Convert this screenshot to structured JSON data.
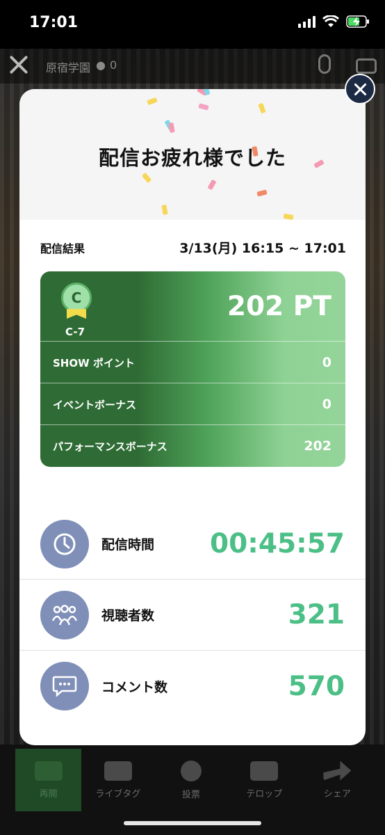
{
  "status_bar": {
    "time": "17:01"
  },
  "stream": {
    "room_name": "原宿学園",
    "viewer_count": "0"
  },
  "toolbar": {
    "items": [
      {
        "label": "再開",
        "icon": "video-camera-icon",
        "active": true
      },
      {
        "label": "ライブタグ",
        "icon": "hashtag-icon",
        "active": false
      },
      {
        "label": "投票",
        "icon": "vote-icon",
        "active": false
      },
      {
        "label": "テロップ",
        "icon": "telop-icon",
        "active": false
      },
      {
        "label": "シェア",
        "icon": "share-icon",
        "active": false
      }
    ]
  },
  "modal": {
    "title": "配信お疲れ様でした",
    "result_label": "配信結果",
    "date_range": "3/13(月) 16:15 ~ 17:01",
    "points_card": {
      "medal_letter": "C",
      "rank": "C-7",
      "total": "202 PT",
      "rows": [
        {
          "label": "SHOW ポイント",
          "value": "0"
        },
        {
          "label": "イベントボーナス",
          "value": "0"
        },
        {
          "label": "パフォーマンスボーナス",
          "value": "202"
        }
      ]
    },
    "stats": [
      {
        "label": "配信時間",
        "value": "00:45:57",
        "icon": "clock-icon"
      },
      {
        "label": "視聴者数",
        "value": "321",
        "icon": "people-icon"
      },
      {
        "label": "コメント数",
        "value": "570",
        "icon": "comment-icon"
      }
    ]
  },
  "colors": {
    "accent_green": "#4cbf87",
    "card_dark_green": "#2f6c35",
    "card_light_green": "#94d49a",
    "stat_icon_bg": "#7f8fb8",
    "close_button_bg": "#1c2a44"
  }
}
